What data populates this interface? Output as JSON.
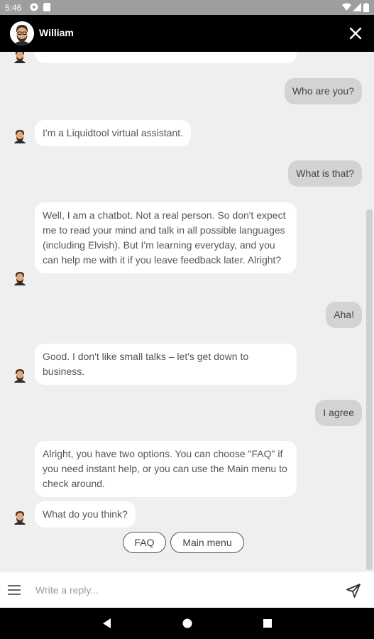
{
  "status": {
    "time": "5:46"
  },
  "header": {
    "name": "William"
  },
  "messages": [
    {
      "from": "user",
      "text": "Who are you?"
    },
    {
      "from": "bot",
      "text": "I'm a Liquidtool virtual assistant."
    },
    {
      "from": "user",
      "text": "What is that?"
    },
    {
      "from": "bot",
      "text": "Well, I am a chatbot. Not a real person. So don't expect me to read your mind and talk in all possible languages (including Elvish). But I'm learning everyday, and you can help me with it if you leave feedback later. Alright?"
    },
    {
      "from": "user",
      "text": "Aha!"
    },
    {
      "from": "bot",
      "text": "Good. I don't like small talks – let's get down to business."
    },
    {
      "from": "user",
      "text": "I agree"
    },
    {
      "from": "bot",
      "text": "Alright, you have two options. You can choose \"FAQ\" if you need instant help, or you can use the Main menu to check around."
    },
    {
      "from": "bot",
      "text": "What do you think?"
    }
  ],
  "quick_replies": [
    "FAQ",
    "Main menu"
  ],
  "composer": {
    "placeholder": "Write a reply..."
  }
}
